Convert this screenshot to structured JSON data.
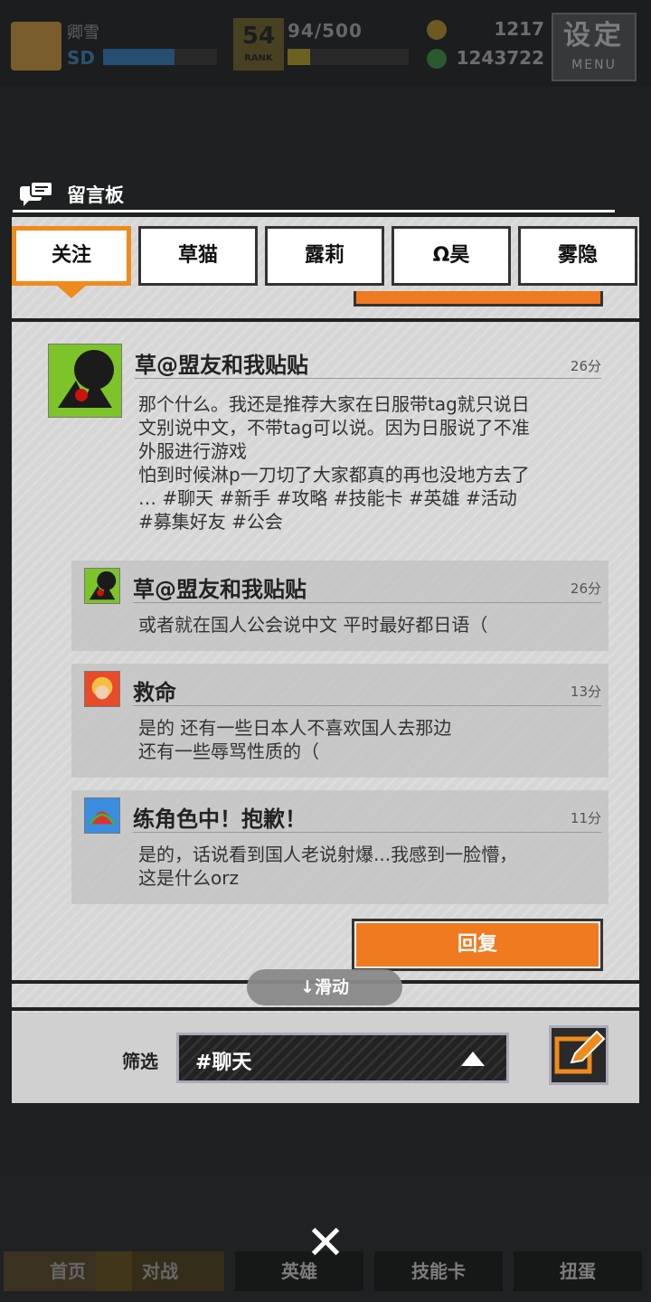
{
  "topbar": {
    "player_name": "卿雪",
    "sd_label": "SD",
    "rank_number": "54",
    "rank_label": "RANK",
    "exp": "94/500",
    "gold": "1217",
    "gems": "1243722",
    "menu_big": "设定",
    "menu_small": "MENU",
    "sd_progress": 0.63,
    "exp_progress": 0.19
  },
  "board": {
    "title": "留言板",
    "tabs": [
      "关注",
      "草猫",
      "露莉",
      "Ω昊",
      "雾隐"
    ],
    "active_tab": 0
  },
  "thread": {
    "author": "草@盟友和我贴贴",
    "time": "26分",
    "body_lines": [
      "那个什么。我还是推荐大家在日服带tag就只说日",
      "文别说中文，不带tag可以说。因为日服说了不准",
      "外服进行游戏",
      "怕到时候淋p一刀切了大家都真的再也没地方去了",
      "… #聊天 #新手 #攻略 #技能卡 #英雄 #活动",
      "#募集好友 #公会"
    ],
    "replies": [
      {
        "author": "草@盟友和我贴贴",
        "time": "26分",
        "lines": [
          "或者就在国人公会说中文 平时最好都日语（"
        ]
      },
      {
        "author": "救命",
        "time": "13分",
        "lines": [
          "是的 还有一些日本人不喜欢国人去那边",
          "还有一些辱骂性质的（"
        ]
      },
      {
        "author": "练角色中！抱歉！",
        "time": "11分",
        "lines": [
          "是的，话说看到国人老说射爆...我感到一脸懵，",
          "这是什么orz"
        ]
      }
    ],
    "reply_button": "回复"
  },
  "scroll_hint": "↓滑动",
  "filter": {
    "label": "筛选",
    "value": "#聊天"
  },
  "bottom_nav": [
    "首页",
    "对战",
    "英雄",
    "技能卡",
    "扭蛋"
  ],
  "colors": {
    "accent": "#f07a20",
    "panel": "#d6d6d6",
    "background": "#1f2022"
  },
  "icons": {
    "board_title": "chat-bubbles-icon",
    "close": "close-icon",
    "compose": "edit-pencil-icon",
    "filter_arrow": "triangle-up-icon"
  }
}
